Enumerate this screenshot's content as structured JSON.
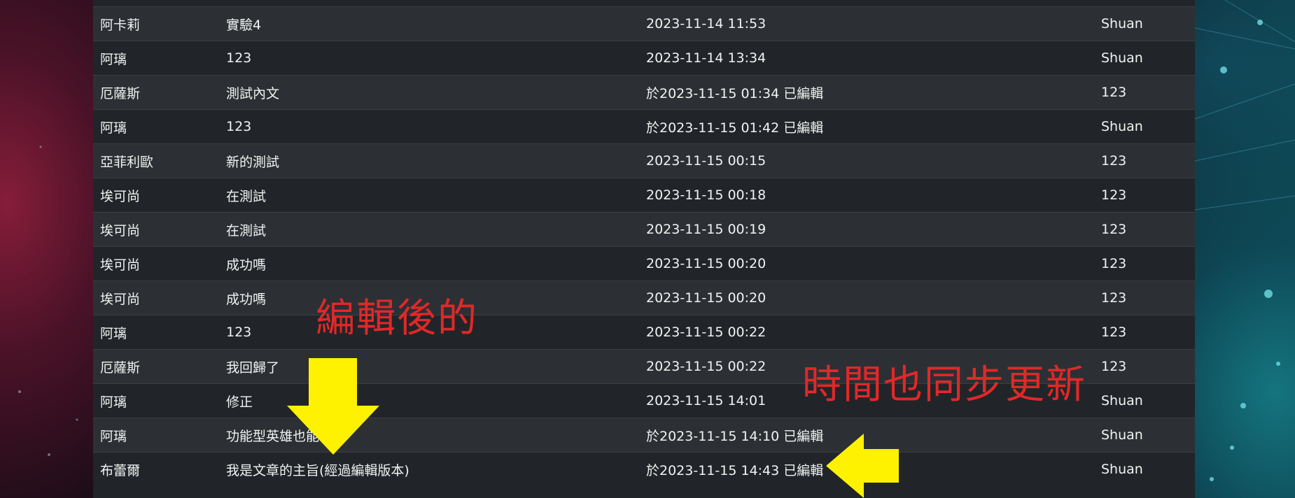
{
  "rows": [
    {
      "author": "阿卡莉",
      "content": "實驗4",
      "time": "2023-11-14 11:53",
      "user": "Shuan"
    },
    {
      "author": "阿璃",
      "content": "123",
      "time": "2023-11-14 13:34",
      "user": "Shuan"
    },
    {
      "author": "厄薩斯",
      "content": "測試內文",
      "time": "於2023-11-15 01:34 已編輯",
      "user": "123"
    },
    {
      "author": "阿璃",
      "content": "123",
      "time": "於2023-11-15 01:42 已編輯",
      "user": "Shuan"
    },
    {
      "author": "亞菲利歐",
      "content": "新的測試",
      "time": "2023-11-15 00:15",
      "user": "123"
    },
    {
      "author": "埃可尚",
      "content": "在測試",
      "time": "2023-11-15 00:18",
      "user": "123"
    },
    {
      "author": "埃可尚",
      "content": "在測試",
      "time": "2023-11-15 00:19",
      "user": "123"
    },
    {
      "author": "埃可尚",
      "content": "成功嗎",
      "time": "2023-11-15 00:20",
      "user": "123"
    },
    {
      "author": "埃可尚",
      "content": "成功嗎",
      "time": "2023-11-15 00:20",
      "user": "123"
    },
    {
      "author": "阿璃",
      "content": "123",
      "time": "2023-11-15 00:22",
      "user": "123"
    },
    {
      "author": "厄薩斯",
      "content": "我回歸了",
      "time": "2023-11-15 00:22",
      "user": "123"
    },
    {
      "author": "阿璃",
      "content": "修正",
      "time": "2023-11-15 14:01",
      "user": "Shuan"
    },
    {
      "author": "阿璃",
      "content": "功能型英雄也能輸出",
      "time": "於2023-11-15 14:10 已編輯",
      "user": "Shuan"
    },
    {
      "author": "布蕾爾",
      "content": "我是文章的主旨(經過編輯版本)",
      "time": "於2023-11-15 14:43 已編輯",
      "user": "Shuan"
    }
  ],
  "annotations": {
    "edited": "編輯後的",
    "time_synced": "時間也同步更新"
  },
  "colors": {
    "row_odd": "#2c3034",
    "row_even": "#212529",
    "annotation_text": "#e12828",
    "arrow": "#fff200"
  }
}
